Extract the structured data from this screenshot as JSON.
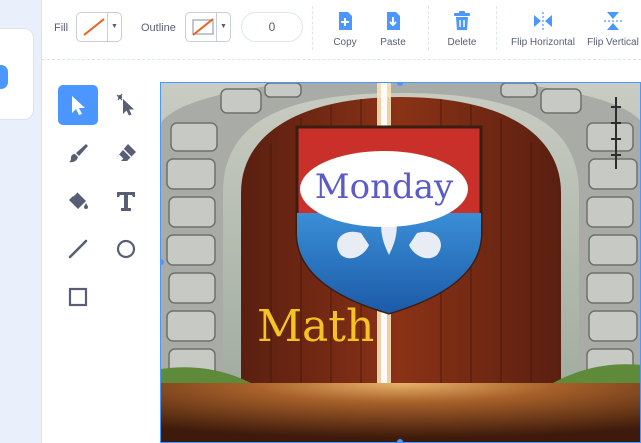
{
  "toolbar": {
    "fill_label": "Fill",
    "outline_label": "Outline",
    "outline_width": "0",
    "copy_label": "Copy",
    "paste_label": "Paste",
    "delete_label": "Delete",
    "flip_horizontal_label": "Flip Horizontal",
    "flip_vertical_label": "Flip Vertical",
    "fill_icon": "no-fill-slash-icon",
    "outline_icon": "no-outline-slash-icon"
  },
  "tools": [
    {
      "name": "select-tool",
      "icon": "arrow-pointer-icon",
      "selected": true
    },
    {
      "name": "reshape-tool",
      "icon": "reshape-pointer-icon",
      "selected": false
    },
    {
      "name": "brush-tool",
      "icon": "brush-icon",
      "selected": false
    },
    {
      "name": "eraser-tool",
      "icon": "eraser-icon",
      "selected": false
    },
    {
      "name": "fill-tool",
      "icon": "paint-bucket-icon",
      "selected": false
    },
    {
      "name": "text-tool",
      "icon": "text-t-icon",
      "selected": false
    },
    {
      "name": "line-tool",
      "icon": "line-icon",
      "selected": false
    },
    {
      "name": "circle-tool",
      "icon": "circle-icon",
      "selected": false
    },
    {
      "name": "rectangle-tool",
      "icon": "square-icon",
      "selected": false
    }
  ],
  "canvas": {
    "banner_text": "Monday",
    "subject_text": "Math"
  },
  "colors": {
    "accent": "#4c97ff",
    "delete_icon": "#4c97ff",
    "fill_slash": "#e8621c",
    "text_muted": "#575e75",
    "banner_text": "#5a5bc9",
    "subject_text": "#f5c422"
  }
}
